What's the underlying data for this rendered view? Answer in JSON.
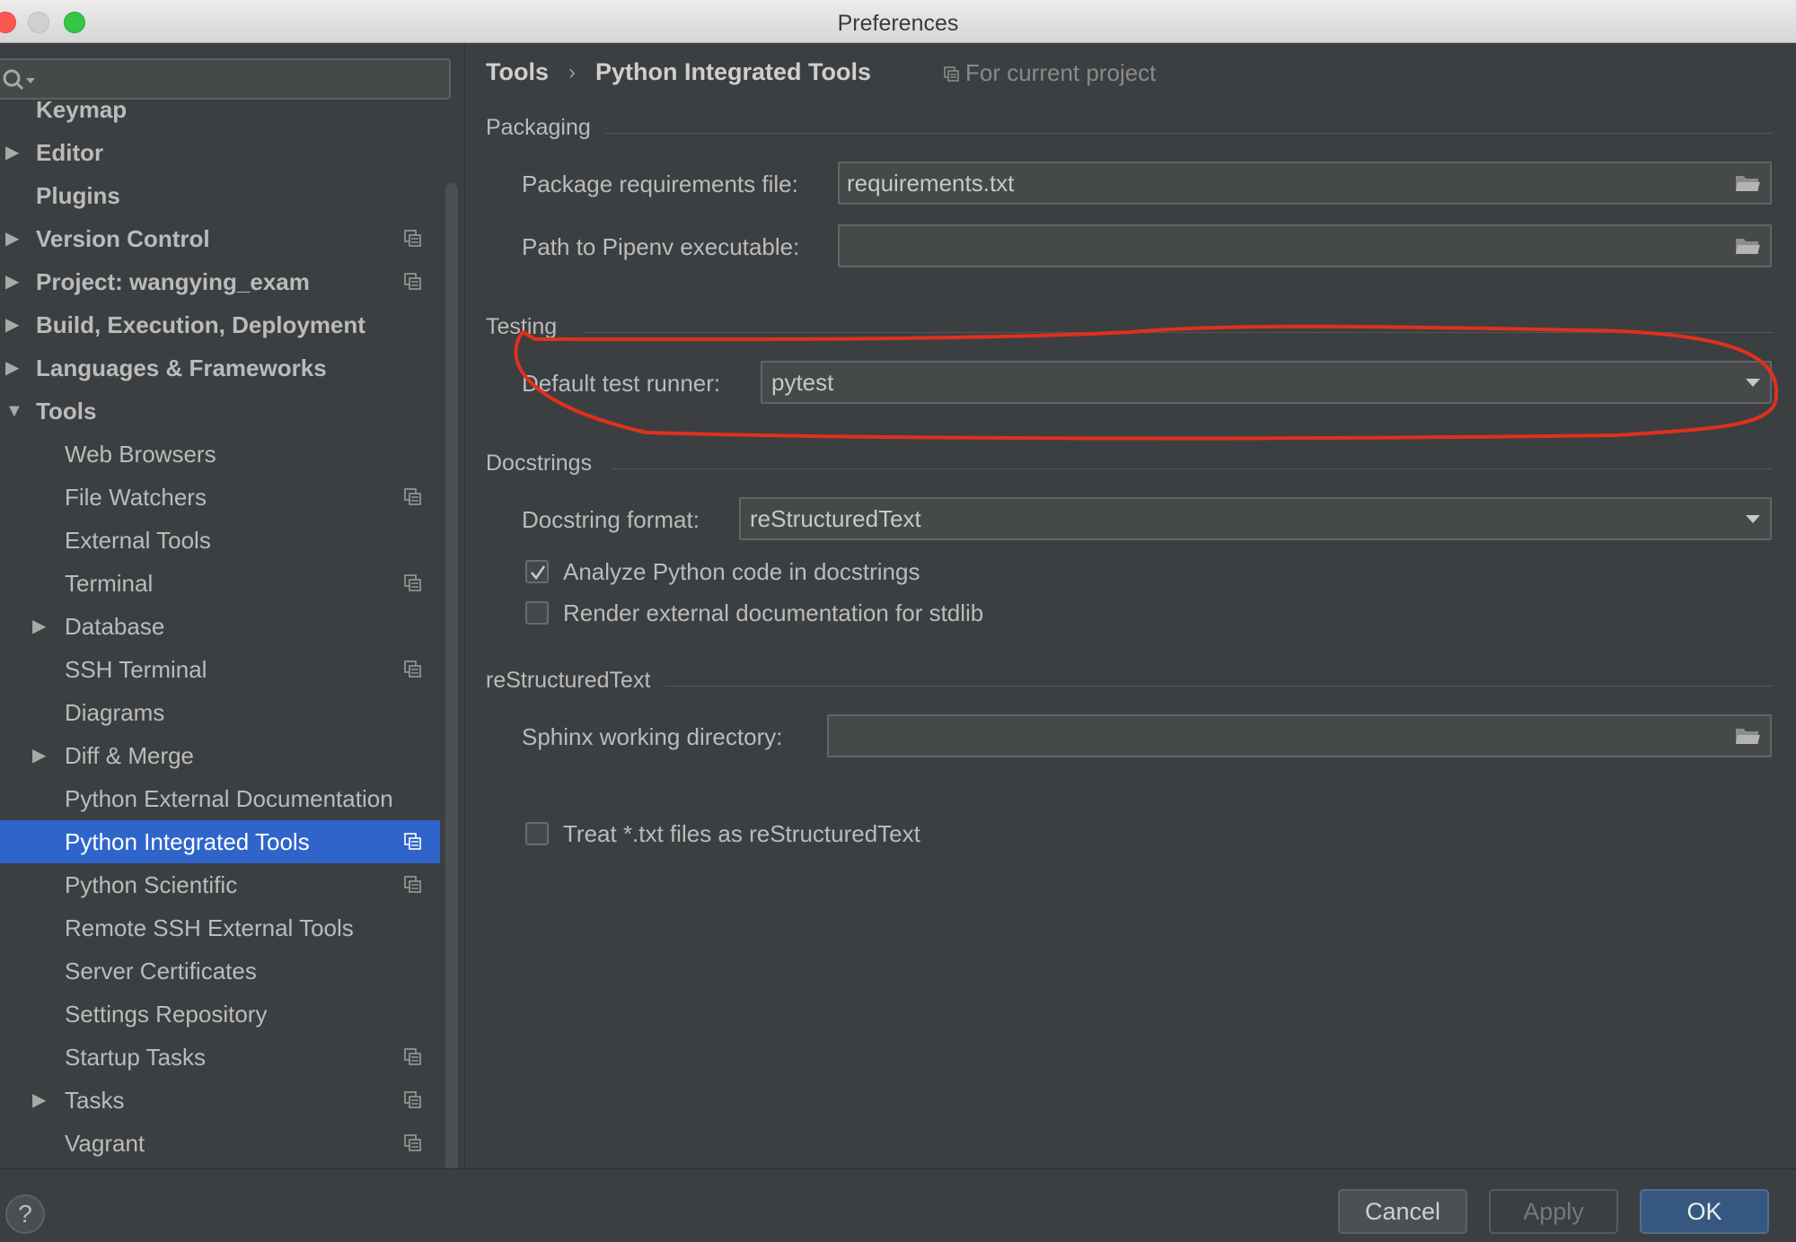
{
  "window": {
    "title": "Preferences"
  },
  "search": {
    "placeholder": "",
    "icon": "search-icon"
  },
  "sidebar": {
    "items": [
      {
        "label": "Keymap",
        "indent": 0,
        "bold": true,
        "arrow": false,
        "project_icon": false
      },
      {
        "label": "Editor",
        "indent": 0,
        "bold": true,
        "arrow": "collapsed",
        "project_icon": false
      },
      {
        "label": "Plugins",
        "indent": 0,
        "bold": true,
        "arrow": false,
        "project_icon": false
      },
      {
        "label": "Version Control",
        "indent": 0,
        "bold": true,
        "arrow": "collapsed",
        "project_icon": true
      },
      {
        "label": "Project: wangying_exam",
        "indent": 0,
        "bold": true,
        "arrow": "collapsed",
        "project_icon": true
      },
      {
        "label": "Build, Execution, Deployment",
        "indent": 0,
        "bold": true,
        "arrow": "collapsed",
        "project_icon": false
      },
      {
        "label": "Languages & Frameworks",
        "indent": 0,
        "bold": true,
        "arrow": "collapsed",
        "project_icon": false
      },
      {
        "label": "Tools",
        "indent": 0,
        "bold": true,
        "arrow": "expanded",
        "project_icon": false
      },
      {
        "label": "Web Browsers",
        "indent": 1,
        "bold": false,
        "arrow": false,
        "project_icon": false
      },
      {
        "label": "File Watchers",
        "indent": 1,
        "bold": false,
        "arrow": false,
        "project_icon": true
      },
      {
        "label": "External Tools",
        "indent": 1,
        "bold": false,
        "arrow": false,
        "project_icon": false
      },
      {
        "label": "Terminal",
        "indent": 1,
        "bold": false,
        "arrow": false,
        "project_icon": true
      },
      {
        "label": "Database",
        "indent": 1,
        "bold": false,
        "arrow": "collapsed",
        "project_icon": false
      },
      {
        "label": "SSH Terminal",
        "indent": 1,
        "bold": false,
        "arrow": false,
        "project_icon": true
      },
      {
        "label": "Diagrams",
        "indent": 1,
        "bold": false,
        "arrow": false,
        "project_icon": false
      },
      {
        "label": "Diff & Merge",
        "indent": 1,
        "bold": false,
        "arrow": "collapsed",
        "project_icon": false
      },
      {
        "label": "Python External Documentation",
        "indent": 1,
        "bold": false,
        "arrow": false,
        "project_icon": false
      },
      {
        "label": "Python Integrated Tools",
        "indent": 1,
        "bold": false,
        "arrow": false,
        "project_icon": true,
        "selected": true
      },
      {
        "label": "Python Scientific",
        "indent": 1,
        "bold": false,
        "arrow": false,
        "project_icon": true
      },
      {
        "label": "Remote SSH External Tools",
        "indent": 1,
        "bold": false,
        "arrow": false,
        "project_icon": false
      },
      {
        "label": "Server Certificates",
        "indent": 1,
        "bold": false,
        "arrow": false,
        "project_icon": false
      },
      {
        "label": "Settings Repository",
        "indent": 1,
        "bold": false,
        "arrow": false,
        "project_icon": false
      },
      {
        "label": "Startup Tasks",
        "indent": 1,
        "bold": false,
        "arrow": false,
        "project_icon": true
      },
      {
        "label": "Tasks",
        "indent": 1,
        "bold": false,
        "arrow": "collapsed",
        "project_icon": true
      },
      {
        "label": "Vagrant",
        "indent": 1,
        "bold": false,
        "arrow": false,
        "project_icon": true
      }
    ]
  },
  "header": {
    "breadcrumb": [
      "Tools",
      "Python Integrated Tools"
    ],
    "separator": "›",
    "scope": "For current project"
  },
  "packaging": {
    "title": "Packaging",
    "requirements_label": "Package requirements file:",
    "requirements_value": "requirements.txt",
    "pipenv_label": "Path to Pipenv executable:",
    "pipenv_value": ""
  },
  "testing": {
    "title": "Testing",
    "runner_label": "Default test runner:",
    "runner_value": "pytest"
  },
  "docstrings": {
    "title": "Docstrings",
    "format_label": "Docstring format:",
    "format_value": "reStructuredText",
    "analyze_label": "Analyze Python code in docstrings",
    "analyze_checked": true,
    "render_label": "Render external documentation for stdlib",
    "render_checked": false
  },
  "restructured": {
    "title": "reStructuredText",
    "sphinx_label": "Sphinx working directory:",
    "sphinx_value": "",
    "treat_label": "Treat *.txt files as reStructuredText",
    "treat_checked": false
  },
  "buttons": {
    "help": "?",
    "cancel": "Cancel",
    "apply": "Apply",
    "ok": "OK"
  },
  "colors": {
    "selection": "#2f65ca",
    "annotation": "#e0301e",
    "background": "#3c3f41"
  }
}
